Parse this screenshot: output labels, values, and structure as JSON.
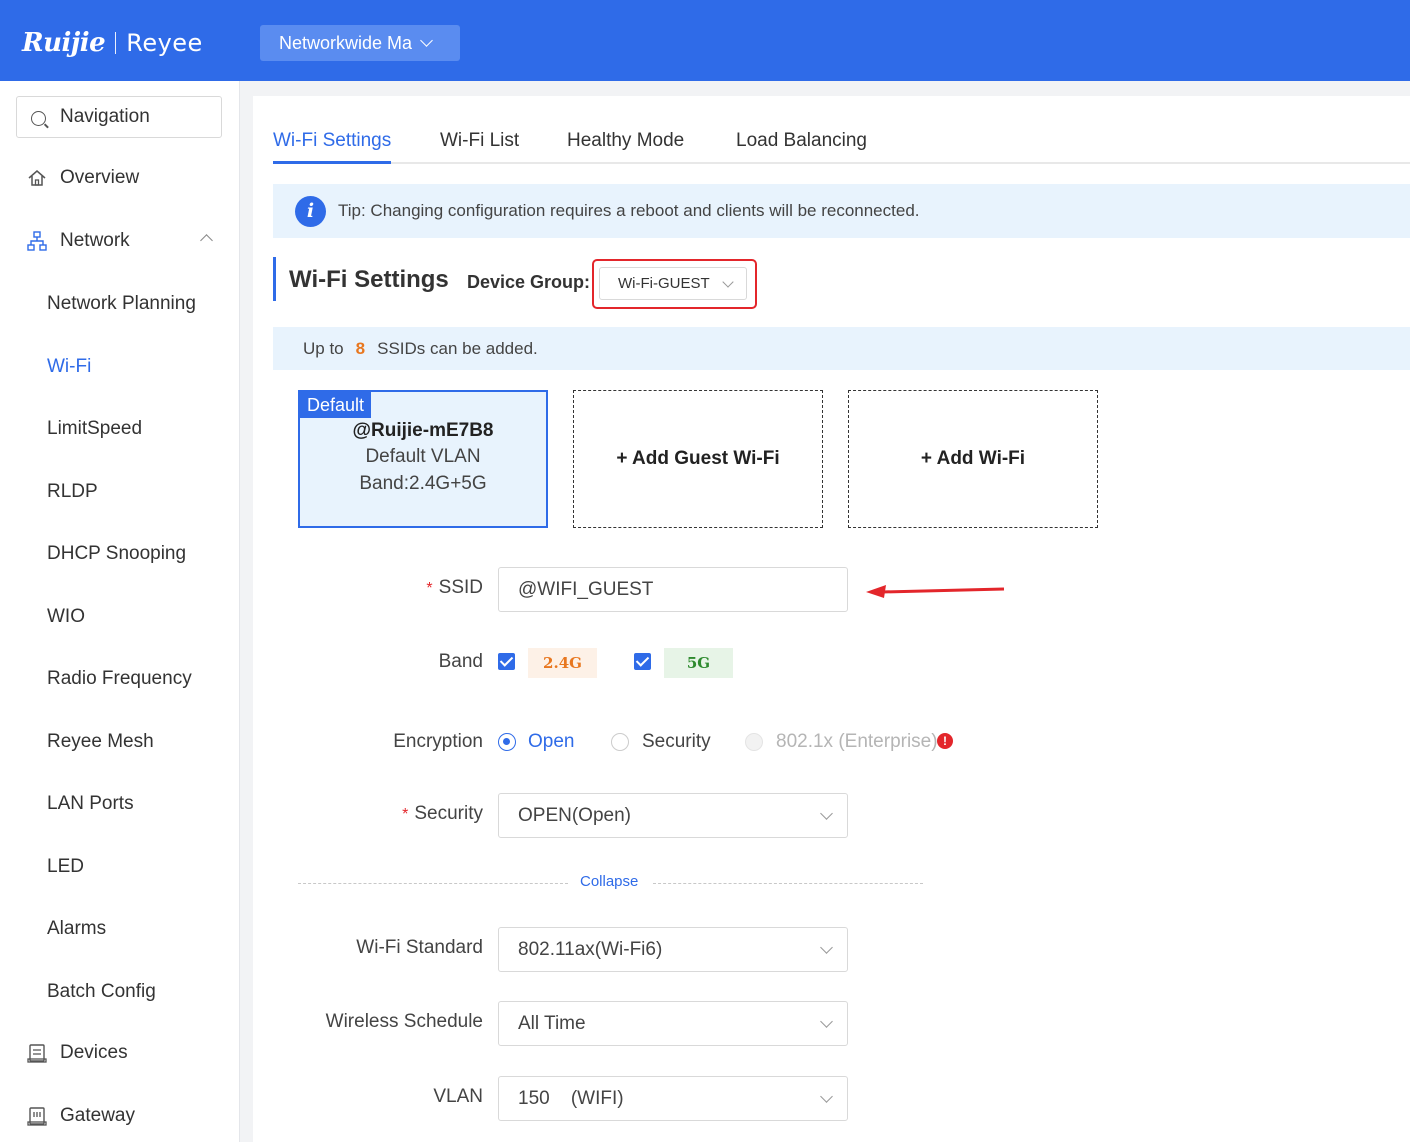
{
  "header": {
    "logo_main": "Ruijie",
    "logo_sub": "Reyee",
    "network_select": "Networkwide Ma"
  },
  "sidebar": {
    "search_label": "Navigation",
    "items": [
      {
        "label": "Overview"
      },
      {
        "label": "Network"
      },
      {
        "label": "Network Planning"
      },
      {
        "label": "Wi-Fi"
      },
      {
        "label": "LimitSpeed"
      },
      {
        "label": "RLDP"
      },
      {
        "label": "DHCP Snooping"
      },
      {
        "label": "WIO"
      },
      {
        "label": "Radio Frequency"
      },
      {
        "label": "Reyee Mesh"
      },
      {
        "label": "LAN Ports"
      },
      {
        "label": "LED"
      },
      {
        "label": "Alarms"
      },
      {
        "label": "Batch Config"
      },
      {
        "label": "Devices"
      },
      {
        "label": "Gateway"
      }
    ]
  },
  "tabs": [
    "Wi-Fi Settings",
    "Wi-Fi List",
    "Healthy Mode",
    "Load Balancing"
  ],
  "tip": "Tip: Changing configuration requires a reboot and clients will be reconnected.",
  "section": {
    "title": "Wi-Fi Settings",
    "group_label": "Device Group:",
    "group_value": "Wi-Fi-GUEST"
  },
  "ssid_info": {
    "prefix": "Up to",
    "count": "8",
    "suffix": "SSIDs can be added."
  },
  "cards": {
    "default_badge": "Default",
    "default_name": "@Ruijie-mE7B8",
    "default_vlan": "Default VLAN",
    "default_band": "Band:2.4G+5G",
    "add_guest": "+ Add Guest Wi-Fi",
    "add_wifi": "+ Add Wi-Fi"
  },
  "form": {
    "ssid_label": "SSID",
    "ssid_value": "@WIFI_GUEST",
    "band_label": "Band",
    "band_24": "2.4G",
    "band_5": "5G",
    "encryption_label": "Encryption",
    "enc_open": "Open",
    "enc_security": "Security",
    "enc_enterprise": "802.1x (Enterprise)",
    "security_label": "Security",
    "security_value": "OPEN(Open)",
    "collapse": "Collapse",
    "standard_label": "Wi-Fi Standard",
    "standard_value": "802.11ax(Wi-Fi6)",
    "schedule_label": "Wireless Schedule",
    "schedule_value": "All Time",
    "vlan_label": "VLAN",
    "vlan_value": "150    (WIFI)"
  },
  "colors": {
    "accent": "#2f6be8",
    "highlight_red": "#e3262b",
    "band_24_text": "#e8771f",
    "band_24_bg": "#fdf1e7",
    "band_5_text": "#2e8a2e",
    "band_5_bg": "#e7f4e7"
  }
}
